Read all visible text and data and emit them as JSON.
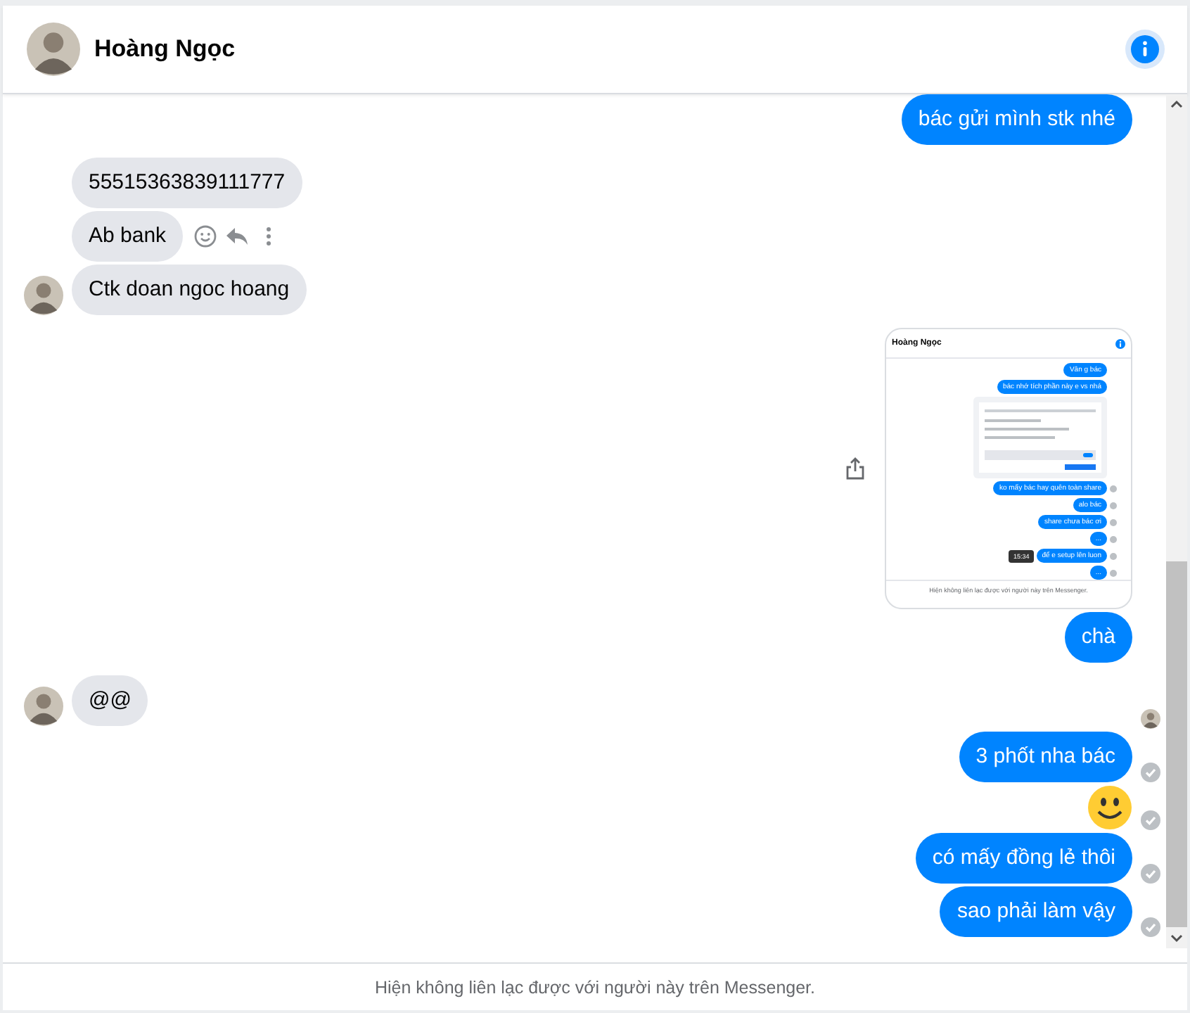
{
  "header": {
    "name": "Hoàng Ngọc"
  },
  "messages": [
    {
      "kind": "text",
      "outgoing": true,
      "text": "bác gửi mình stk nhé",
      "delivered": false
    },
    {
      "kind": "text",
      "outgoing": false,
      "text": "55515363839111777",
      "avatar": false,
      "actions": false
    },
    {
      "kind": "text",
      "outgoing": false,
      "text": "Ab bank",
      "avatar": false,
      "actions": true
    },
    {
      "kind": "text",
      "outgoing": false,
      "text": "Ctk doan ngoc hoang",
      "avatar": true,
      "actions": false
    },
    {
      "kind": "screenshot",
      "outgoing": true,
      "delivered": false,
      "screenshot": {
        "title": "Hoàng Ngọc",
        "messages": [
          {
            "kind": "text",
            "text": "Vân g bác",
            "delivered": false
          },
          {
            "kind": "text",
            "text": "bác nhớ tích phần này e vs nhá",
            "delivered": false
          },
          {
            "kind": "picture",
            "delivered": false
          },
          {
            "kind": "text",
            "text": "ko mấy bác hay quên toàn share",
            "delivered": true
          },
          {
            "kind": "text",
            "text": "alo bác",
            "delivered": true
          },
          {
            "kind": "text",
            "text": "share chưa bác ơi",
            "delivered": true
          },
          {
            "kind": "text",
            "text": "...",
            "delivered": true
          },
          {
            "kind": "text",
            "text": "để e setup lên luon",
            "time": "15:34",
            "delivered": true
          },
          {
            "kind": "text",
            "text": "...",
            "delivered": true
          }
        ],
        "footer": "Hiện không liên lạc được với người này trên Messenger."
      }
    },
    {
      "kind": "text",
      "outgoing": true,
      "text": "chà",
      "delivered": false
    },
    {
      "kind": "text",
      "outgoing": false,
      "text": "@@",
      "avatar": true,
      "actions": false
    },
    {
      "kind": "seen"
    },
    {
      "kind": "text",
      "outgoing": true,
      "text": "3 phốt nha bác",
      "delivered": true
    },
    {
      "kind": "emoji",
      "outgoing": true,
      "delivered": true
    },
    {
      "kind": "text",
      "outgoing": true,
      "text": "có mấy đồng lẻ thôi",
      "delivered": true
    },
    {
      "kind": "text",
      "outgoing": true,
      "text": "sao phải làm vậy",
      "delivered": true
    }
  ],
  "footer": {
    "notice": "Hiện không liên lạc được với người này trên Messenger."
  }
}
